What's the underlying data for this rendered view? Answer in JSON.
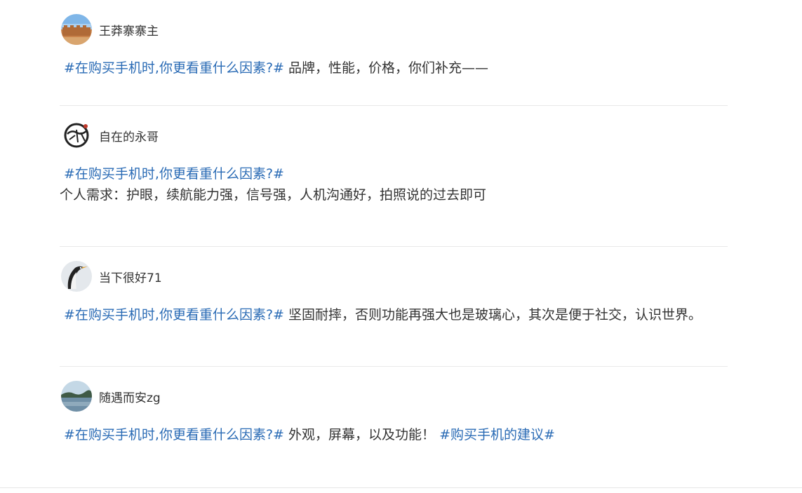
{
  "posts": [
    {
      "author": "王莽寨寨主",
      "avatar": "landscape-fortress-icon",
      "topic": "#在购买手机时,你更看重什么因素?#",
      "text": " 品牌，性能，价格，你们补充——"
    },
    {
      "author": "自在的永哥",
      "avatar": "calligraphy-logo-icon",
      "topic": "#在购买手机时,你更看重什么因素?#",
      "text": "个人需求：护眼，续航能力强，信号强，人机沟通好，拍照说的过去即可"
    },
    {
      "author": "当下很好71",
      "avatar": "penguin-icon",
      "topic": "#在购买手机时,你更看重什么因素?#",
      "text": " 坚固耐摔，否则功能再强大也是玻璃心，其次是便于社交，认识世界。"
    },
    {
      "author": "随遇而安zg",
      "avatar": "lake-scenery-icon",
      "topic": "#在购买手机时,你更看重什么因素?#",
      "text": " 外观，屏幕，以及功能！ ",
      "topic2": "#购买手机的建议#"
    }
  ],
  "colors": {
    "topic": "#2a6bb5",
    "text": "#333333",
    "divider": "#e9e9e9"
  }
}
